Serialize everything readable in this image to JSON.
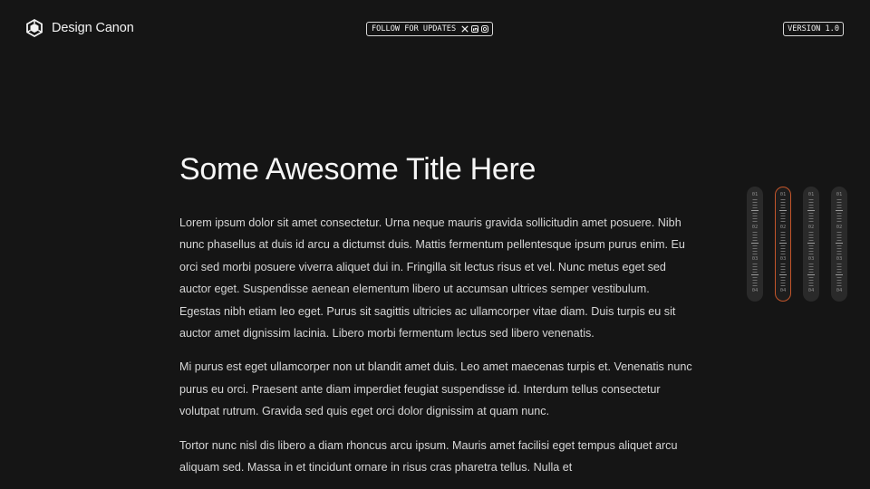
{
  "header": {
    "brand_name": "Design Canon",
    "brand_icon": "design-canon-logo-icon",
    "follow_label": "FOLLOW FOR UPDATES",
    "social_icons": [
      "x-icon",
      "linkedin-icon",
      "instagram-icon"
    ],
    "version_label": "VERSION 1.0"
  },
  "article": {
    "title": "Some Awesome Title Here",
    "paragraphs": [
      "Lorem ipsum dolor sit amet consectetur. Urna neque mauris gravida sollicitudin amet posuere. Nibh nunc phasellus at duis id arcu a dictumst duis. Mattis fermentum pellentesque ipsum purus enim. Eu orci sed morbi posuere viverra aliquet dui in. Fringilla sit lectus risus et vel. Nunc metus eget sed auctor eget. Suspendisse aenean elementum libero ut accumsan ultrices semper vestibulum. Egestas nibh etiam leo eget. Purus sit sagittis ultricies ac ullamcorper vitae diam. Duis turpis eu sit auctor amet dignissim lacinia. Libero morbi fermentum lectus sed libero venenatis.",
      "Mi purus est eget ullamcorper non ut blandit amet duis. Leo amet maecenas turpis et. Venenatis nunc purus eu orci. Praesent ante diam imperdiet feugiat suspendisse id. Interdum tellus consectetur volutpat rutrum. Gravida sed quis eget orci dolor dignissim at quam nunc.",
      "Tortor nunc nisl dis libero a diam rhoncus arcu ipsum. Mauris amet facilisi eget tempus aliquet arcu aliquam sed. Massa in et tincidunt ornare in risus cras pharetra tellus. Nulla et"
    ]
  },
  "pills": {
    "labels": [
      "01",
      "02",
      "03",
      "04"
    ],
    "active_index": 1,
    "accent_color": "#c2552a",
    "count": 4
  },
  "colors": {
    "background": "#151515",
    "text": "#e8e8e8"
  }
}
